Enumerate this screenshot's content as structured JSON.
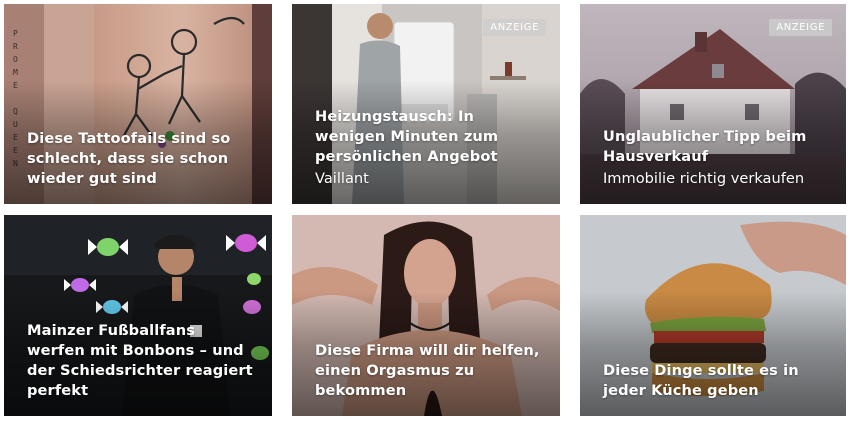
{
  "cards": [
    {
      "title": "Diese Tattoofails sind so schlecht, dass sie schon wieder gut sind",
      "sponsor": "",
      "badge": "",
      "image_text": "PROME QUEEN"
    },
    {
      "title": "Heizungstausch: In wenigen Minuten zum persönlichen Angebot",
      "sponsor": "Vaillant",
      "badge": "ANZEIGE"
    },
    {
      "title": "Unglaublicher Tipp beim Hausverkauf",
      "sponsor": "Immobilie richtig verkaufen",
      "badge": "ANZEIGE"
    },
    {
      "title": "Mainzer Fußballfans werfen mit Bonbons – und der Schiedsrichter reagiert perfekt",
      "sponsor": "",
      "badge": ""
    },
    {
      "title": "Diese Firma will dir helfen, einen Orgasmus zu bekommen",
      "sponsor": "",
      "badge": ""
    },
    {
      "title": "Diese Dinge sollte es in jeder Küche geben",
      "sponsor": "",
      "badge": ""
    }
  ]
}
